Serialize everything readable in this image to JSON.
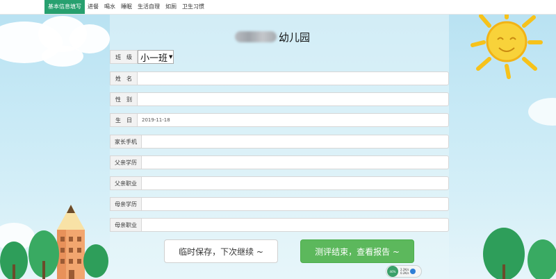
{
  "nav": {
    "tabs": [
      "基本信息填写",
      "进餐",
      "喝水",
      "睡眠",
      "生活自理",
      "如厕",
      "卫生习惯"
    ],
    "active": 0
  },
  "header": {
    "name_suffix": "幼儿园"
  },
  "form": {
    "class": {
      "label": "班级",
      "value": "小一班"
    },
    "name": {
      "label": "姓名",
      "value": ""
    },
    "gender": {
      "label": "性别",
      "value": ""
    },
    "birthday": {
      "label": "生日",
      "value": "2019-11-18"
    },
    "parent_phone": {
      "label": "家长手机",
      "value": ""
    },
    "father_edu": {
      "label": "父亲学历",
      "value": ""
    },
    "father_job": {
      "label": "父亲职业",
      "value": ""
    },
    "mother_edu": {
      "label": "母亲学历",
      "value": ""
    },
    "mother_job": {
      "label": "母亲职业",
      "value": ""
    }
  },
  "buttons": {
    "save": "临时保存，下次继续 ~",
    "submit": "测评结束，查看报告 ~"
  },
  "net_monitor": {
    "percent": "46%",
    "up": "2.2K/s",
    "down": "0.2K/s"
  },
  "colors": {
    "nav_active": "#27a06f",
    "submit": "#5cb85c",
    "sky": "#c9eaf6",
    "tree": "#2e9e5a",
    "sun": "#f6c21b"
  },
  "icons": [
    "sun-icon",
    "pencil-house-icon",
    "tree-icon",
    "cloud-icon"
  ]
}
